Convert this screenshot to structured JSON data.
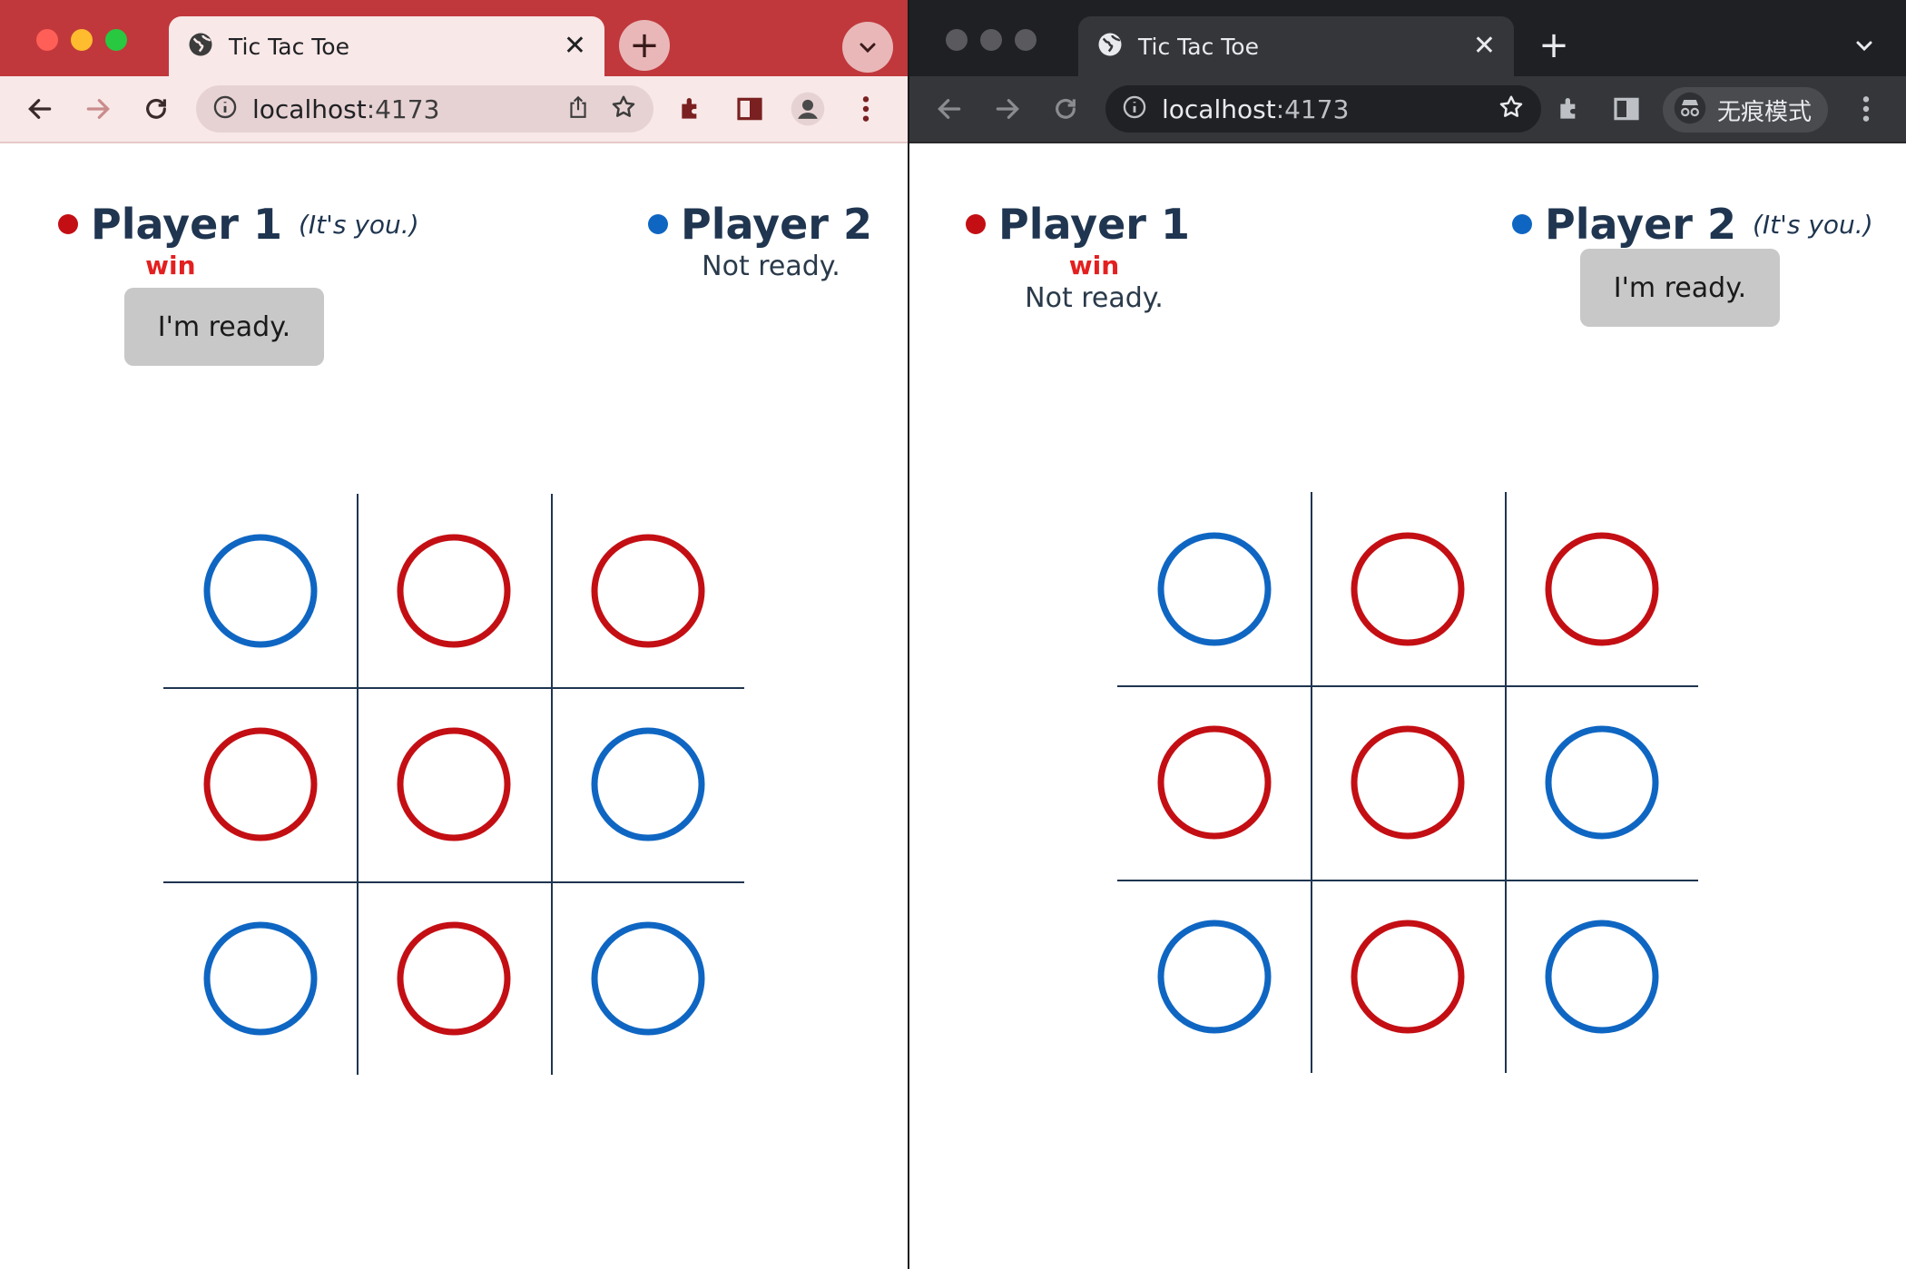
{
  "colors": {
    "player1": "#c30f14",
    "player2": "#0f66c2",
    "grid": "#1f3550",
    "win": "#e32020"
  },
  "windows": [
    {
      "id": "normal",
      "tab_title": "Tic Tac Toe",
      "url_host": "localhost",
      "url_port": ":4173",
      "icons": [
        "globe-icon",
        "close-icon",
        "plus-icon",
        "chevron-down-icon",
        "back-icon",
        "forward-icon",
        "reload-icon",
        "info-icon",
        "share-icon",
        "star-icon",
        "puzzle-icon",
        "sidepanel-icon",
        "profile-icon",
        "kebab-menu-icon"
      ],
      "player1": {
        "name": "Player 1",
        "you_label": "(It's you.)",
        "result": "win",
        "ready_button": "I'm ready."
      },
      "player2": {
        "name": "Player 2",
        "status": "Not ready."
      },
      "board": [
        "P2",
        "P1",
        "P1",
        "P1",
        "P1",
        "P2",
        "P2",
        "P1",
        "P2"
      ]
    },
    {
      "id": "incognito",
      "tab_title": "Tic Tac Toe",
      "url_host": "localhost",
      "url_port": ":4173",
      "incognito_label": "无痕模式",
      "icons": [
        "globe-icon",
        "close-icon",
        "plus-icon",
        "chevron-down-icon",
        "back-icon",
        "forward-icon",
        "reload-icon",
        "info-icon",
        "star-icon",
        "puzzle-icon",
        "sidepanel-icon",
        "incognito-icon",
        "kebab-menu-icon"
      ],
      "player1": {
        "name": "Player 1",
        "result": "win",
        "status": "Not ready."
      },
      "player2": {
        "name": "Player 2",
        "you_label": "(It's you.)",
        "ready_button": "I'm ready."
      },
      "board": [
        "P2",
        "P1",
        "P1",
        "P1",
        "P1",
        "P2",
        "P2",
        "P1",
        "P2"
      ]
    }
  ]
}
